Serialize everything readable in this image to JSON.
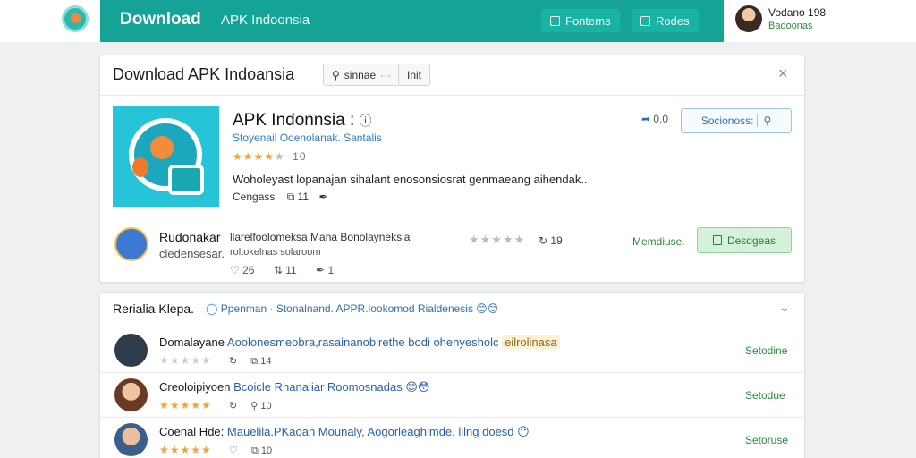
{
  "topbar": {
    "brand": "Download",
    "nav_label": "APK Indoonsia",
    "btn1_label": "Fontems",
    "btn2_label": "Rodes",
    "user_name": "Vodano 198",
    "user_sub": "Badoonas"
  },
  "dialog": {
    "title": "Download APK Indoansia",
    "pill1": "sinnae",
    "pill2": "Init",
    "close": "×"
  },
  "app": {
    "title": "APK Indonnsia :",
    "meta": "Stoyenail  Ooenolanak.  Santalis",
    "stars": "★★★★",
    "rating": "10",
    "description": "Woholeyast lopanajan sihalant enosonsiosrat genmaeang aihendak..",
    "extra_label": "Cengass",
    "extra_count": "11",
    "share_count": "0.0",
    "share_label": "Socionoss:"
  },
  "developer": {
    "name": "Rudonakar",
    "sub": "cledensesar.",
    "mid_line": "llarelfoolomeksa   Mana Bonolayneksia",
    "mid_sub": "roltokelnas solaroom",
    "stars": "★★★★★",
    "count": "19",
    "likes": "26",
    "shares": "11",
    "comments": "1",
    "link": "Memdiuse.",
    "button": "Desdgeas"
  },
  "reviews": {
    "heading": "Rerialia Klepa.",
    "links": "Ppenman  ·  Stonalnand.   APPR.lookomod Rialdenesis",
    "chevron": "⌄",
    "items": [
      {
        "name": "Domalayane",
        "text": "Aoolonesmeobra,rasainanobirethe bodi ohenyesholc",
        "tag": "eilrolinasa",
        "stars": "★★★★★",
        "count": "14",
        "action": "Setodine",
        "avatar_color": "#2f3b4a"
      },
      {
        "name": "Creoloipiyoen",
        "text": "Bcoicle Rhanaliar Roomosnadas",
        "tag": "",
        "stars": "★★★★★",
        "count": "10",
        "action": "Setodue",
        "avatar_color": "#8a5a3c"
      },
      {
        "name": "Coenal Hde:",
        "text": "Mauelila.PKaoan Mounaly, Aogorleaghimde, lilng doesd",
        "tag": "",
        "stars": "★★★★★",
        "count": "10",
        "action": "Setoruse",
        "avatar_color": "#3a5f8a"
      }
    ]
  }
}
